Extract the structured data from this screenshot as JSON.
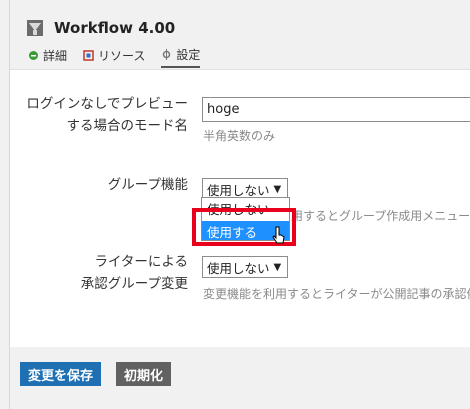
{
  "header": {
    "title": "Workflow 4.00",
    "icon": "workflow-logo-icon"
  },
  "tabs": [
    {
      "label": "詳細",
      "icon": "detail-icon"
    },
    {
      "label": "リソース",
      "icon": "resource-icon"
    },
    {
      "label": "設定",
      "icon": "settings-icon",
      "active": true
    }
  ],
  "form": {
    "preview_mode": {
      "label_line1": "ログインなしでプレビュー",
      "label_line2": "する場合のモード名",
      "value": "hoge",
      "hint": "半角英数のみ"
    },
    "group_feature": {
      "label": "グループ機能",
      "selected": "使用しない",
      "hint_partial": "用するとグループ作成用メニュー",
      "options": [
        "使用しない",
        "使用する"
      ],
      "highlighted_option": "使用する"
    },
    "writer_group": {
      "label_line1": "ライターによる",
      "label_line2": "承認グループ変更",
      "selected": "使用しない",
      "hint": "変更機能を利用するとライターが公開記事の承認依"
    }
  },
  "buttons": {
    "save": "変更を保存",
    "reset": "初期化"
  },
  "colors": {
    "save_button": "#1f6fb3",
    "reset_button": "#616161",
    "highlight_border": "#e8001c",
    "selected_option": "#1e90ff"
  }
}
